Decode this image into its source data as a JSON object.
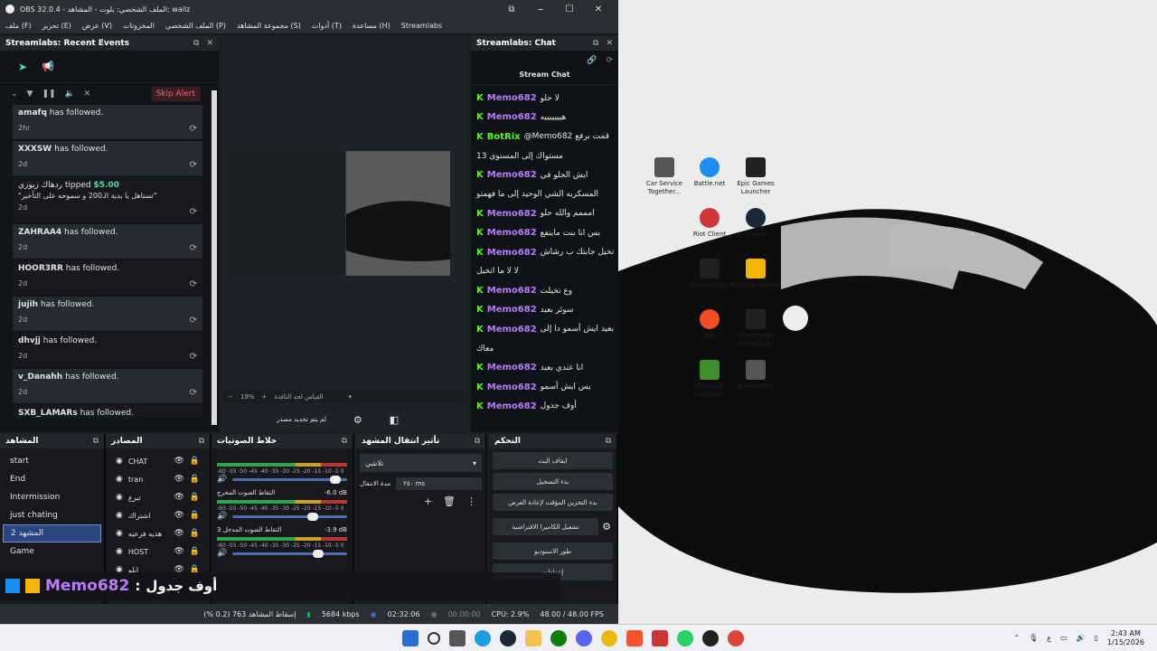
{
  "window": {
    "title": "OBS 32.0.4 - الملف الشخصي: بلوت - المشاهد: wailz",
    "minimize": "⎯",
    "restore": "☐",
    "close": "✕",
    "pin": "⧉"
  },
  "menu": [
    "ملف (F)",
    "تحرير (E)",
    "عرض (V)",
    "المخزونات",
    "الملف الشخصي (P)",
    "مجموعة المشاهد (S)",
    "أدوات (T)",
    "مساعدة (H)",
    "Streamlabs"
  ],
  "events_dock": {
    "title": "Streamlabs: Recent Events",
    "skip_alert": "Skip Alert",
    "items": [
      {
        "name": "amafq",
        "action": "has followed.",
        "time": "2hr"
      },
      {
        "name": "XXXSW",
        "action": "has followed.",
        "time": "2d"
      },
      {
        "name": "ردهاك زيوزي",
        "action": "tipped",
        "amount": "$5.00",
        "message": "\"تستاهل يا بدية الـ200 و سموحه على التأخير\"",
        "time": "2d"
      },
      {
        "name": "ZAHRAA4",
        "action": "has followed.",
        "time": "2d"
      },
      {
        "name": "HOOR3RR",
        "action": "has followed.",
        "time": "2d"
      },
      {
        "name": "jujih",
        "action": "has followed.",
        "time": "2d"
      },
      {
        "name": "dhvjj",
        "action": "has followed.",
        "time": "2d"
      },
      {
        "name": "v_Danahh",
        "action": "has followed.",
        "time": "2d"
      },
      {
        "name": "SXB_LAMARs",
        "action": "has followed.",
        "time": ""
      }
    ]
  },
  "preview": {
    "zoom": "19%",
    "zoom_label": "القياس لحد النافذة",
    "no_source": "لم يتم تحديد مصدر"
  },
  "chat_dock": {
    "title": "Streamlabs: Chat",
    "subtitle": "Stream Chat",
    "messages": [
      {
        "user": "Memo682",
        "text": "لا حلو"
      },
      {
        "user": "Memo682",
        "text": "هيييييييه"
      },
      {
        "user": "BotRix",
        "text": "@Memo682 قمت برفع"
      },
      {
        "user": "",
        "text": "مستواك إلى المستوى 13"
      },
      {
        "user": "Memo682",
        "text": "ايش الحلو في"
      },
      {
        "user": "",
        "text": "المسكريه الشي الوحيد إلى ما فهمتو"
      },
      {
        "user": "Memo682",
        "text": "امممم والله حلو"
      },
      {
        "user": "Memo682",
        "text": "بس انا بنت مايتفع"
      },
      {
        "user": "Memo682",
        "text": "تخيل جابتك ب رشاش"
      },
      {
        "user": "",
        "text": "لا لا ما اتخيل"
      },
      {
        "user": "Memo682",
        "text": "وع تخيلت"
      },
      {
        "user": "Memo682",
        "text": "سوئر بعيد"
      },
      {
        "user": "Memo682",
        "text": "بعيد ايش أسمو دا إلى"
      },
      {
        "user": "",
        "text": "معاك"
      },
      {
        "user": "Memo682",
        "text": "انا عندي بعيد"
      },
      {
        "user": "Memo682",
        "text": "بس ايش أسمو"
      },
      {
        "user": "Memo682",
        "text": "أوف جدول"
      }
    ]
  },
  "scenes": {
    "title": "المشاهد",
    "items": [
      "start",
      "End",
      "Intermission",
      "just chating",
      "المشهد 2",
      "Game"
    ],
    "selected": 4
  },
  "sources": {
    "title": "المصادر",
    "items": [
      "CHAT",
      "tran",
      "تبرع",
      "اشتراك",
      "هديه فرعيه",
      "HOST",
      "ابلو"
    ]
  },
  "mixer": {
    "title": "خلاط الصوتيات",
    "channels": [
      {
        "name": "",
        "db": "",
        "level": 0.85
      },
      {
        "name": "التقاط الصوت المخرج",
        "db": "-6.0 dB",
        "level": 0.65
      },
      {
        "name": "التقاط الصوت المدخل 3",
        "db": "-3.9 dB",
        "level": 0.7
      }
    ],
    "scale": "-60 -55 -50 -45 -40 -35 -30 -25 -20 -15 -10 -5 0"
  },
  "transitions": {
    "title": "تأثير انتقال المشهد",
    "type": "تلاشي",
    "duration_label": "مدة الانتقال",
    "duration": "٢٥٠ ms"
  },
  "controls": {
    "title": "التحكم",
    "buttons": [
      "ايقاف البث",
      "بدء التسجيل",
      "بدء التخزين المؤقت لإعادة العرض",
      "تشغيل الكاميرا الافتراضية",
      "طور الاستوديو",
      "إعدادات"
    ]
  },
  "overlay": {
    "user": "Memo682",
    "sep": ":",
    "text": "أوف جدول"
  },
  "status": {
    "dropped": "إسقاط المشاهد 763 (0.2 %)",
    "bitrate": "5684 kbps",
    "stream_time": "02:32:06",
    "rec_time": "00:00:00",
    "cpu": "CPU: 2.9%",
    "fps": "48.00 / 48.00 FPS"
  },
  "desktop_icons": [
    {
      "label": "Car Service Together...",
      "color": "#444"
    },
    {
      "label": "Battle.net",
      "color": "#1b8ef2"
    },
    {
      "label": "Epic Games Launcher",
      "color": "#222"
    },
    {
      "label": "Riot Client",
      "color": "#d13639"
    },
    {
      "label": "Steam",
      "color": "#1b2838"
    },
    {
      "label": "CurseForge",
      "color": "#222"
    },
    {
      "label": "Rockstar Games ...",
      "color": "#f2b705"
    },
    {
      "label": "EA",
      "color": "#f04e23"
    },
    {
      "label": "CurseForge Installer (1)",
      "color": "#222"
    },
    {
      "label": "Minecraft Launcher",
      "color": "#3e8e2b"
    },
    {
      "label": "BakkesMod",
      "color": "#555"
    }
  ],
  "taskbar": {
    "time": "2:43 AM",
    "date": "1/15/2026",
    "lang": "ع"
  }
}
